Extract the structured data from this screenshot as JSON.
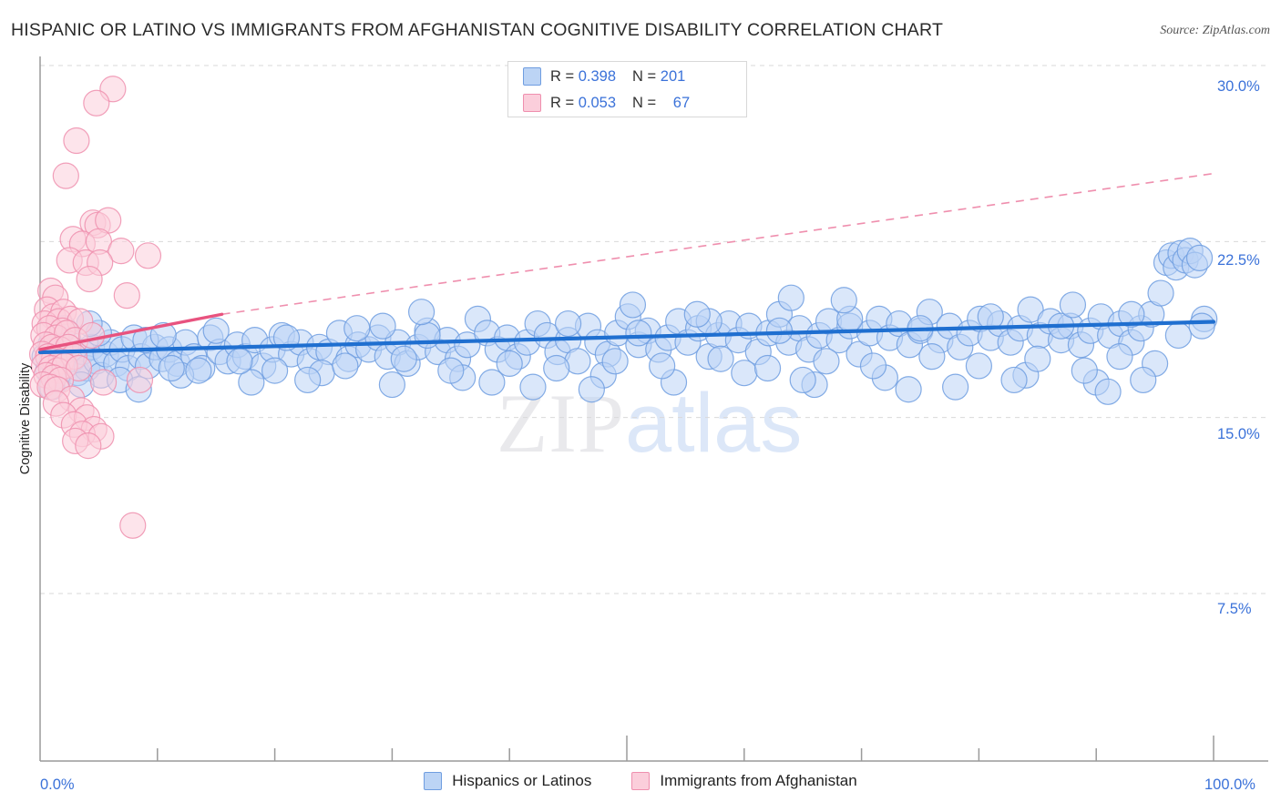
{
  "header": {
    "title": "HISPANIC OR LATINO VS IMMIGRANTS FROM AFGHANISTAN COGNITIVE DISABILITY CORRELATION CHART",
    "source": "Source: ZipAtlas.com"
  },
  "watermark": {
    "part1": "ZIP",
    "part2": "atlas"
  },
  "stats_legend": {
    "rows": [
      {
        "series": "Hispanics or Latinos",
        "r_label": "R =",
        "r_value": "0.398",
        "n_label": "N =",
        "n_value": "201",
        "color": "#bcd4f5"
      },
      {
        "series": "Immigrants from Afghanistan",
        "r_label": "R =",
        "r_value": "0.053",
        "n_label": "N =",
        "n_value": "67",
        "color": "#fbcedb"
      }
    ]
  },
  "bottom_legend": {
    "items": [
      {
        "label": "Hispanics or Latinos",
        "color": "#bcd4f5"
      },
      {
        "label": "Immigrants from Afghanistan",
        "color": "#fbcedb"
      }
    ]
  },
  "chart_data": {
    "type": "scatter",
    "title": "HISPANIC OR LATINO VS IMMIGRANTS FROM AFGHANISTAN COGNITIVE DISABILITY CORRELATION CHART",
    "xlabel": "",
    "ylabel": "Cognitive Disability",
    "xlim": [
      0,
      100
    ],
    "ylim": [
      0,
      32.6
    ],
    "xticks": [
      "0.0%",
      "100.0%"
    ],
    "yticks": [
      "7.5%",
      "15.0%",
      "22.5%",
      "30.0%"
    ],
    "ytick_values": [
      7.5,
      15.0,
      22.5,
      30.0
    ],
    "grid": "horizontal-dashed",
    "legend_position": "bottom-center",
    "series": [
      {
        "name": "Hispanics or Latinos",
        "color": "#bcd4f5",
        "stroke": "#6f9de0",
        "r": 0.398,
        "n": 201,
        "trendline": {
          "style": "solid",
          "color": "#1f6fd0",
          "x0": 0,
          "y0": 17.78,
          "x1": 100,
          "y1": 19.08
        },
        "points": [
          [
            0.4,
            17.6
          ],
          [
            0.7,
            17.0
          ],
          [
            0.9,
            18.1
          ],
          [
            1.2,
            17.3
          ],
          [
            1.5,
            16.6
          ],
          [
            1.8,
            17.9
          ],
          [
            2.1,
            17.2
          ],
          [
            2.4,
            18.3
          ],
          [
            2.8,
            17.5
          ],
          [
            3.2,
            16.9
          ],
          [
            3.6,
            17.8
          ],
          [
            4.0,
            17.1
          ],
          [
            4.4,
            18.0
          ],
          [
            4.8,
            17.4
          ],
          [
            5.2,
            16.8
          ],
          [
            5.6,
            17.7
          ],
          [
            6.0,
            18.2
          ],
          [
            6.5,
            17.3
          ],
          [
            7.0,
            17.9
          ],
          [
            7.5,
            17.1
          ],
          [
            8.0,
            18.4
          ],
          [
            8.6,
            17.6
          ],
          [
            9.2,
            17.2
          ],
          [
            9.8,
            18.0
          ],
          [
            10.4,
            17.5
          ],
          [
            11.0,
            17.9
          ],
          [
            11.7,
            17.3
          ],
          [
            12.4,
            18.2
          ],
          [
            13.1,
            17.6
          ],
          [
            13.8,
            17.1
          ],
          [
            14.5,
            18.4
          ],
          [
            15.3,
            17.8
          ],
          [
            16.0,
            17.4
          ],
          [
            16.8,
            18.1
          ],
          [
            17.5,
            17.6
          ],
          [
            18.3,
            18.3
          ],
          [
            19.0,
            17.2
          ],
          [
            19.8,
            17.9
          ],
          [
            20.6,
            18.5
          ],
          [
            21.4,
            17.7
          ],
          [
            22.2,
            18.2
          ],
          [
            23.0,
            17.4
          ],
          [
            23.8,
            18.0
          ],
          [
            24.6,
            17.8
          ],
          [
            25.5,
            18.6
          ],
          [
            26.3,
            17.5
          ],
          [
            27.1,
            18.1
          ],
          [
            28.0,
            17.9
          ],
          [
            28.8,
            18.4
          ],
          [
            29.6,
            17.6
          ],
          [
            30.5,
            18.2
          ],
          [
            31.3,
            17.3
          ],
          [
            32.2,
            18.0
          ],
          [
            33.0,
            18.7
          ],
          [
            33.9,
            17.8
          ],
          [
            34.7,
            18.3
          ],
          [
            35.6,
            17.5
          ],
          [
            36.4,
            18.1
          ],
          [
            37.3,
            19.2
          ],
          [
            38.1,
            18.6
          ],
          [
            39.0,
            17.9
          ],
          [
            39.8,
            18.4
          ],
          [
            40.7,
            17.6
          ],
          [
            41.5,
            18.2
          ],
          [
            42.4,
            19.0
          ],
          [
            43.2,
            18.5
          ],
          [
            44.1,
            17.8
          ],
          [
            45.0,
            18.3
          ],
          [
            45.8,
            17.4
          ],
          [
            46.7,
            18.9
          ],
          [
            47.5,
            18.2
          ],
          [
            48.4,
            17.7
          ],
          [
            49.2,
            18.6
          ],
          [
            50.1,
            19.3
          ],
          [
            51.0,
            18.1
          ],
          [
            51.8,
            18.7
          ],
          [
            52.7,
            17.9
          ],
          [
            53.5,
            18.4
          ],
          [
            54.4,
            19.1
          ],
          [
            55.2,
            18.2
          ],
          [
            56.1,
            18.8
          ],
          [
            57.0,
            17.6
          ],
          [
            57.8,
            18.5
          ],
          [
            58.7,
            19.0
          ],
          [
            59.5,
            18.3
          ],
          [
            60.4,
            18.9
          ],
          [
            61.2,
            17.8
          ],
          [
            62.1,
            18.6
          ],
          [
            63.0,
            19.4
          ],
          [
            63.8,
            18.2
          ],
          [
            64.7,
            18.8
          ],
          [
            65.5,
            17.9
          ],
          [
            66.4,
            18.5
          ],
          [
            67.2,
            19.1
          ],
          [
            68.1,
            18.3
          ],
          [
            69.0,
            18.9
          ],
          [
            69.8,
            17.7
          ],
          [
            70.7,
            18.6
          ],
          [
            71.5,
            19.2
          ],
          [
            72.4,
            18.4
          ],
          [
            73.2,
            19.0
          ],
          [
            74.1,
            18.1
          ],
          [
            75.0,
            18.7
          ],
          [
            75.8,
            19.5
          ],
          [
            76.7,
            18.3
          ],
          [
            77.5,
            18.9
          ],
          [
            78.4,
            18.0
          ],
          [
            79.2,
            18.6
          ],
          [
            80.1,
            19.2
          ],
          [
            81.0,
            18.4
          ],
          [
            81.8,
            19.0
          ],
          [
            82.7,
            18.2
          ],
          [
            83.5,
            18.8
          ],
          [
            84.4,
            19.6
          ],
          [
            85.2,
            18.5
          ],
          [
            86.1,
            19.1
          ],
          [
            87.0,
            18.3
          ],
          [
            87.8,
            18.9
          ],
          [
            88.7,
            18.1
          ],
          [
            89.5,
            18.7
          ],
          [
            90.4,
            19.3
          ],
          [
            91.2,
            18.5
          ],
          [
            92.1,
            19.0
          ],
          [
            93.0,
            18.2
          ],
          [
            93.8,
            18.8
          ],
          [
            94.7,
            19.4
          ],
          [
            95.5,
            20.3
          ],
          [
            96.0,
            21.6
          ],
          [
            96.4,
            21.9
          ],
          [
            96.8,
            21.4
          ],
          [
            97.2,
            22.0
          ],
          [
            97.6,
            21.7
          ],
          [
            98.0,
            22.1
          ],
          [
            98.4,
            21.5
          ],
          [
            98.8,
            21.8
          ],
          [
            99.2,
            19.2
          ],
          [
            12.0,
            16.8
          ],
          [
            18.0,
            16.5
          ],
          [
            24.0,
            16.9
          ],
          [
            30.0,
            16.4
          ],
          [
            36.0,
            16.7
          ],
          [
            42.0,
            16.3
          ],
          [
            48.0,
            16.8
          ],
          [
            54.0,
            16.5
          ],
          [
            60.0,
            16.9
          ],
          [
            66.0,
            16.4
          ],
          [
            72.0,
            16.7
          ],
          [
            78.0,
            16.3
          ],
          [
            84.0,
            16.8
          ],
          [
            90.0,
            16.5
          ],
          [
            5.0,
            18.6
          ],
          [
            9.0,
            18.3
          ],
          [
            15.0,
            18.7
          ],
          [
            21.0,
            18.4
          ],
          [
            27.0,
            18.8
          ],
          [
            33.0,
            18.5
          ],
          [
            45.0,
            19.0
          ],
          [
            51.0,
            18.6
          ],
          [
            57.0,
            19.1
          ],
          [
            63.0,
            18.7
          ],
          [
            69.0,
            19.2
          ],
          [
            75.0,
            18.8
          ],
          [
            81.0,
            19.3
          ],
          [
            87.0,
            18.9
          ],
          [
            93.0,
            19.4
          ],
          [
            2.0,
            18.8
          ],
          [
            3.5,
            16.4
          ],
          [
            6.8,
            16.6
          ],
          [
            10.5,
            18.5
          ],
          [
            13.5,
            17.0
          ],
          [
            17.0,
            17.4
          ],
          [
            20.0,
            17.0
          ],
          [
            26.0,
            17.2
          ],
          [
            31.0,
            17.5
          ],
          [
            35.0,
            17.0
          ],
          [
            40.0,
            17.3
          ],
          [
            44.0,
            17.1
          ],
          [
            49.0,
            17.4
          ],
          [
            53.0,
            17.2
          ],
          [
            58.0,
            17.5
          ],
          [
            62.0,
            17.1
          ],
          [
            67.0,
            17.4
          ],
          [
            71.0,
            17.2
          ],
          [
            76.0,
            17.6
          ],
          [
            80.0,
            17.2
          ],
          [
            85.0,
            17.5
          ],
          [
            89.0,
            17.0
          ],
          [
            92.0,
            17.6
          ],
          [
            95.0,
            17.3
          ],
          [
            97.0,
            18.5
          ],
          [
            99.0,
            18.9
          ],
          [
            8.4,
            16.2
          ],
          [
            11.2,
            17.1
          ],
          [
            22.8,
            16.6
          ],
          [
            29.2,
            18.9
          ],
          [
            38.5,
            16.5
          ],
          [
            47.0,
            16.2
          ],
          [
            56.0,
            19.4
          ],
          [
            65.0,
            16.6
          ],
          [
            74.0,
            16.2
          ],
          [
            83.0,
            16.6
          ],
          [
            91.0,
            16.1
          ],
          [
            94.0,
            16.6
          ],
          [
            88.0,
            19.8
          ],
          [
            68.5,
            20.0
          ],
          [
            64.0,
            20.1
          ],
          [
            50.5,
            19.8
          ],
          [
            32.5,
            19.5
          ],
          [
            1.0,
            16.3
          ],
          [
            4.2,
            19.0
          ]
        ]
      },
      {
        "name": "Immigrants from Afghanistan",
        "color": "#fbcedb",
        "stroke": "#ef8fae",
        "r": 0.053,
        "n": 67,
        "trendline": {
          "style": "solid",
          "color": "#e8537f",
          "x0": 0,
          "y0": 17.9,
          "x1": 15.5,
          "y1": 19.4
        },
        "trendline_extension": {
          "style": "dashed",
          "color": "#ef8fae",
          "x0": 15.5,
          "y0": 19.4,
          "x1": 100,
          "y1": 25.4
        },
        "points": [
          [
            6.2,
            29.0
          ],
          [
            4.8,
            28.4
          ],
          [
            3.1,
            26.8
          ],
          [
            2.2,
            25.3
          ],
          [
            4.5,
            23.3
          ],
          [
            4.9,
            23.2
          ],
          [
            5.8,
            23.4
          ],
          [
            2.8,
            22.6
          ],
          [
            3.6,
            22.4
          ],
          [
            5.0,
            22.5
          ],
          [
            6.9,
            22.1
          ],
          [
            2.5,
            21.7
          ],
          [
            3.9,
            21.6
          ],
          [
            5.1,
            21.6
          ],
          [
            9.2,
            21.9
          ],
          [
            4.2,
            20.9
          ],
          [
            7.4,
            20.2
          ],
          [
            0.9,
            20.4
          ],
          [
            1.3,
            20.1
          ],
          [
            0.6,
            19.6
          ],
          [
            1.1,
            19.3
          ],
          [
            2.0,
            19.5
          ],
          [
            0.4,
            19.0
          ],
          [
            1.6,
            19.1
          ],
          [
            2.6,
            19.2
          ],
          [
            3.4,
            19.1
          ],
          [
            0.8,
            18.8
          ],
          [
            1.9,
            18.7
          ],
          [
            0.3,
            18.5
          ],
          [
            1.4,
            18.4
          ],
          [
            2.3,
            18.6
          ],
          [
            3.0,
            18.3
          ],
          [
            4.4,
            18.5
          ],
          [
            0.5,
            18.1
          ],
          [
            1.0,
            18.0
          ],
          [
            1.7,
            17.9
          ],
          [
            2.4,
            18.0
          ],
          [
            0.2,
            17.7
          ],
          [
            0.7,
            17.6
          ],
          [
            1.2,
            17.5
          ],
          [
            1.8,
            17.4
          ],
          [
            2.9,
            17.6
          ],
          [
            0.35,
            17.2
          ],
          [
            0.95,
            17.1
          ],
          [
            1.5,
            17.0
          ],
          [
            2.1,
            17.2
          ],
          [
            3.3,
            17.1
          ],
          [
            0.55,
            16.8
          ],
          [
            1.15,
            16.7
          ],
          [
            1.75,
            16.6
          ],
          [
            0.25,
            16.4
          ],
          [
            0.85,
            16.3
          ],
          [
            1.45,
            16.2
          ],
          [
            5.4,
            16.5
          ],
          [
            8.5,
            16.6
          ],
          [
            2.7,
            15.8
          ],
          [
            1.35,
            15.6
          ],
          [
            3.5,
            15.3
          ],
          [
            2.0,
            15.1
          ],
          [
            4.0,
            15.0
          ],
          [
            2.9,
            14.7
          ],
          [
            4.6,
            14.5
          ],
          [
            3.6,
            14.3
          ],
          [
            5.2,
            14.2
          ],
          [
            3.0,
            14.0
          ],
          [
            4.1,
            13.8
          ],
          [
            7.9,
            10.4
          ]
        ]
      }
    ]
  },
  "axis": {
    "y_axis_label": "Cognitive Disability",
    "x_min_label": "0.0%",
    "x_max_label": "100.0%"
  }
}
